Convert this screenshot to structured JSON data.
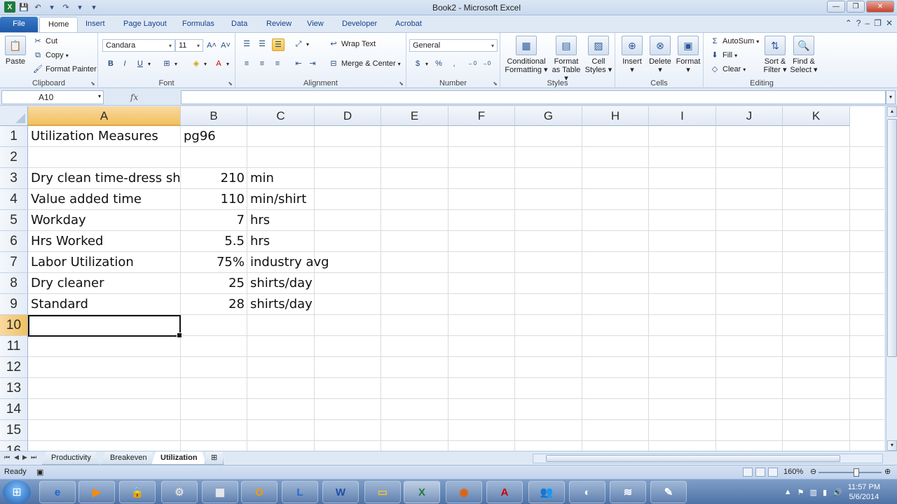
{
  "window": {
    "title": "Book2 - Microsoft Excel"
  },
  "ribbon_tabs": [
    {
      "label": "File"
    },
    {
      "label": "Home"
    },
    {
      "label": "Insert"
    },
    {
      "label": "Page Layout"
    },
    {
      "label": "Formulas"
    },
    {
      "label": "Data"
    },
    {
      "label": "Review"
    },
    {
      "label": "View"
    },
    {
      "label": "Developer"
    },
    {
      "label": "Acrobat"
    }
  ],
  "clipboard": {
    "label": "Clipboard",
    "paste": "Paste",
    "cut": "Cut",
    "copy": "Copy",
    "format_painter": "Format Painter"
  },
  "font": {
    "label": "Font",
    "name": "Candara",
    "size": "11"
  },
  "alignment": {
    "label": "Alignment",
    "wrap_text": "Wrap Text",
    "merge_center": "Merge & Center"
  },
  "number": {
    "label": "Number",
    "format": "General"
  },
  "styles": {
    "label": "Styles",
    "conditional_l1": "Conditional",
    "conditional_l2": "Formatting",
    "format_table_l1": "Format",
    "format_table_l2": "as Table",
    "cell_styles_l1": "Cell",
    "cell_styles_l2": "Styles"
  },
  "cells": {
    "label": "Cells",
    "insert": "Insert",
    "delete": "Delete",
    "format": "Format"
  },
  "editing": {
    "label": "Editing",
    "autosum": "AutoSum",
    "fill": "Fill",
    "clear": "Clear",
    "sort_l1": "Sort &",
    "sort_l2": "Filter",
    "find_l1": "Find &",
    "find_l2": "Select"
  },
  "formula_bar": {
    "name_box": "A10",
    "fx": "fx",
    "value": ""
  },
  "columns": [
    "A",
    "B",
    "C",
    "D",
    "E",
    "F",
    "G",
    "H",
    "I",
    "J",
    "K"
  ],
  "rows": [
    "1",
    "2",
    "3",
    "4",
    "5",
    "6",
    "7",
    "8",
    "9",
    "10",
    "11",
    "12",
    "13",
    "14",
    "15",
    "16"
  ],
  "sheet_rows": [
    {
      "a": "Utilization Measures",
      "b": "pg96",
      "c": ""
    },
    {
      "a": "",
      "b": "",
      "c": ""
    },
    {
      "a": "Dry clean time-dress shi",
      "b": "210",
      "c": "min"
    },
    {
      "a": "Value added time",
      "b": "110",
      "c": "min/shirt"
    },
    {
      "a": "Workday",
      "b": "7",
      "c": "hrs"
    },
    {
      "a": "Hrs Worked",
      "b": "5.5",
      "c": "hrs"
    },
    {
      "a": "Labor Utilization",
      "b": "75%",
      "c": "industry avg"
    },
    {
      "a": "Dry cleaner",
      "b": "25",
      "c": "shirts/day"
    },
    {
      "a": "Standard",
      "b": "28",
      "c": "shirts/day"
    }
  ],
  "sheet_tabs": [
    {
      "label": "Productivity"
    },
    {
      "label": "Breakeven"
    },
    {
      "label": "Utilization"
    }
  ],
  "status": {
    "text": "Ready",
    "zoom": "160%"
  },
  "taskbar": {
    "clock_time": "11:57 PM",
    "clock_date": "5/6/2014"
  },
  "colors": {
    "accent": "#1e5aa8",
    "selection_header": "#f1c15f",
    "excel_green": "#1f7a3e"
  }
}
